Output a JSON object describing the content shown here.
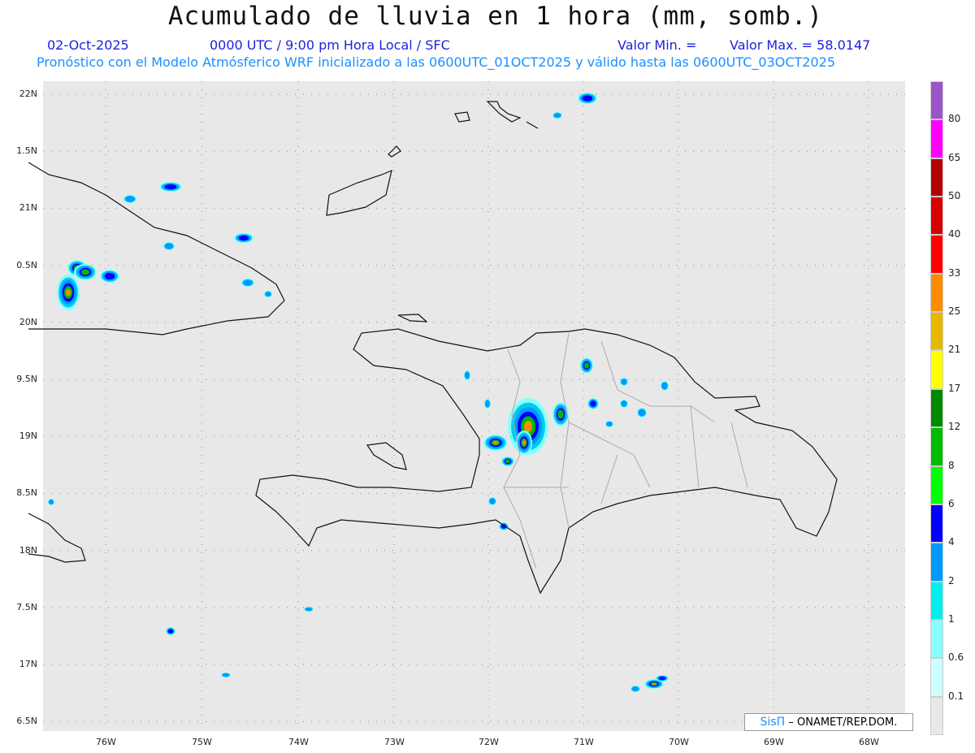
{
  "title": "Acumulado de lluvia en 1 hora (mm, somb.)",
  "date": "02-Oct-2025",
  "time": "0000 UTC / 9:00 pm Hora Local / SFC",
  "valmin": "Valor Min. =",
  "valmax": "Valor Max. = 58.0147",
  "subtitle": "Pronóstico con el Modelo Atmósferico WRF inicializado a las 0600UTC_01OCT2025 y válido hasta las  0600UTC_03OCT2025",
  "lat_labels": [
    "22N",
    "1.5N",
    "21N",
    "0.5N",
    "20N",
    "9.5N",
    "19N",
    "8.5N",
    "18N",
    "7.5N",
    "17N",
    "6.5N"
  ],
  "lon_labels": [
    "76W",
    "75W",
    "74W",
    "73W",
    "72W",
    "71W",
    "70W",
    "69W",
    "68W"
  ],
  "colorbar": {
    "labels": [
      "80",
      "65",
      "50",
      "40",
      "33",
      "25",
      "21",
      "17",
      "12",
      "8",
      "6",
      "4",
      "2",
      "1",
      "0.6",
      "0.1"
    ],
    "colors": [
      "#9a55c8",
      "#ff00ff",
      "#b40000",
      "#d70000",
      "#ff0000",
      "#ff8c00",
      "#e6b800",
      "#ffff00",
      "#008800",
      "#00bb00",
      "#00ff00",
      "#0000ff",
      "#0099ff",
      "#00eeee",
      "#88ffff",
      "#ccffff",
      "#e8e8e8"
    ]
  },
  "credit": {
    "brand": "SisΠ",
    "text": " – ONAMET/REP.DOM."
  }
}
